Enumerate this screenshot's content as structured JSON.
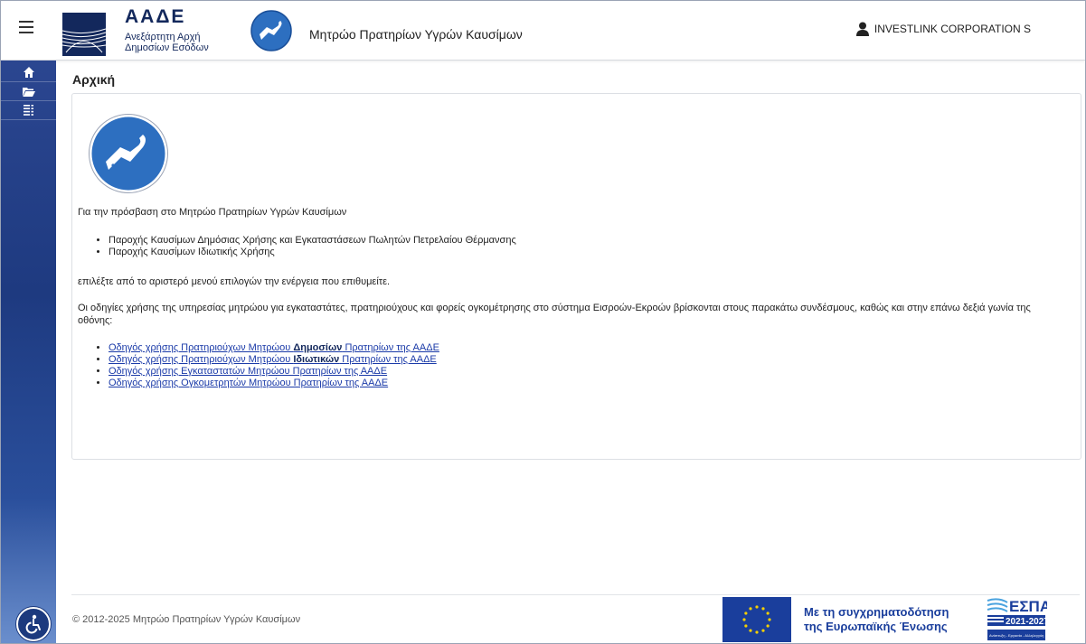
{
  "header": {
    "org_abbr": "ΑΑΔΕ",
    "org_line1": "Ανεξάρτητη Αρχή",
    "org_line2": "Δημοσίων Εσόδων",
    "app_title": "Μητρώο Πρατηρίων Υγρών Καυσίμων",
    "user_name": "INVESTLINK CORPORATION S"
  },
  "sidebar": {
    "items": [
      {
        "icon": "home-icon"
      },
      {
        "icon": "folder-open-icon"
      },
      {
        "icon": "list-icon"
      }
    ]
  },
  "main": {
    "page_title": "Αρχική",
    "intro": "Για την πρόσβαση στο Μητρώο Πρατηρίων Υγρών Καυσίμων",
    "access_types": [
      "Παροχής Καυσίμων Δημόσιας Χρήσης και Εγκαταστάσεων Πωλητών Πετρελαίου Θέρμανσης",
      "Παροχής Καυσίμων Ιδιωτικής Χρήσης"
    ],
    "select_text": "επιλέξτε από το αριστερό μενού επιλογών την ενέργεια που επιθυμείτε.",
    "guides_intro": "Οι οδηγίες χρήσης της υπηρεσίας μητρώου για εγκαταστάτες, πρατηριούχους και φορείς ογκομέτρησης στο σύστημα Εισροών-Εκροών βρίσκονται στους παρακάτω συνδέσμους, καθώς και στην επάνω δεξιά γωνία της οθόνης:",
    "links": [
      {
        "pre": "Οδηγός χρήσης Πρατηριούχων Μητρώου ",
        "bold": "Δημοσίων",
        "post": " Πρατηρίων της ΑΑΔΕ"
      },
      {
        "pre": "Οδηγός χρήσης Πρατηριούχων Μητρώου ",
        "bold": "Ιδιωτικών",
        "post": " Πρατηρίων της ΑΑΔΕ"
      },
      {
        "pre": "Οδηγός χρήσης Εγκαταστατών Μητρώου Πρατηρίων της ΑΑΔΕ",
        "bold": "",
        "post": ""
      },
      {
        "pre": "Οδηγός χρήσης Ογκομετρητών Μητρώου Πρατηρίων της ΑΑΔΕ",
        "bold": "",
        "post": ""
      }
    ]
  },
  "footer": {
    "copyright": "© 2012-2025 Μητρώο Πρατηρίων Υγρών Καυσίμων",
    "eu_line1": "Με τη συγχρηματοδότηση",
    "eu_line2": "της Ευρωπαϊκής Ένωσης",
    "espa_name": "ΕΣΠΑ",
    "espa_years": "2021-2027",
    "espa_motto": "Ανάπτυξη - Εργασία - Αλληλεγγύη"
  },
  "colors": {
    "brand": "#13285c",
    "sidebar": "#1e3a80",
    "link": "#1a3aa8",
    "icon_blue": "#2d6fc0"
  }
}
